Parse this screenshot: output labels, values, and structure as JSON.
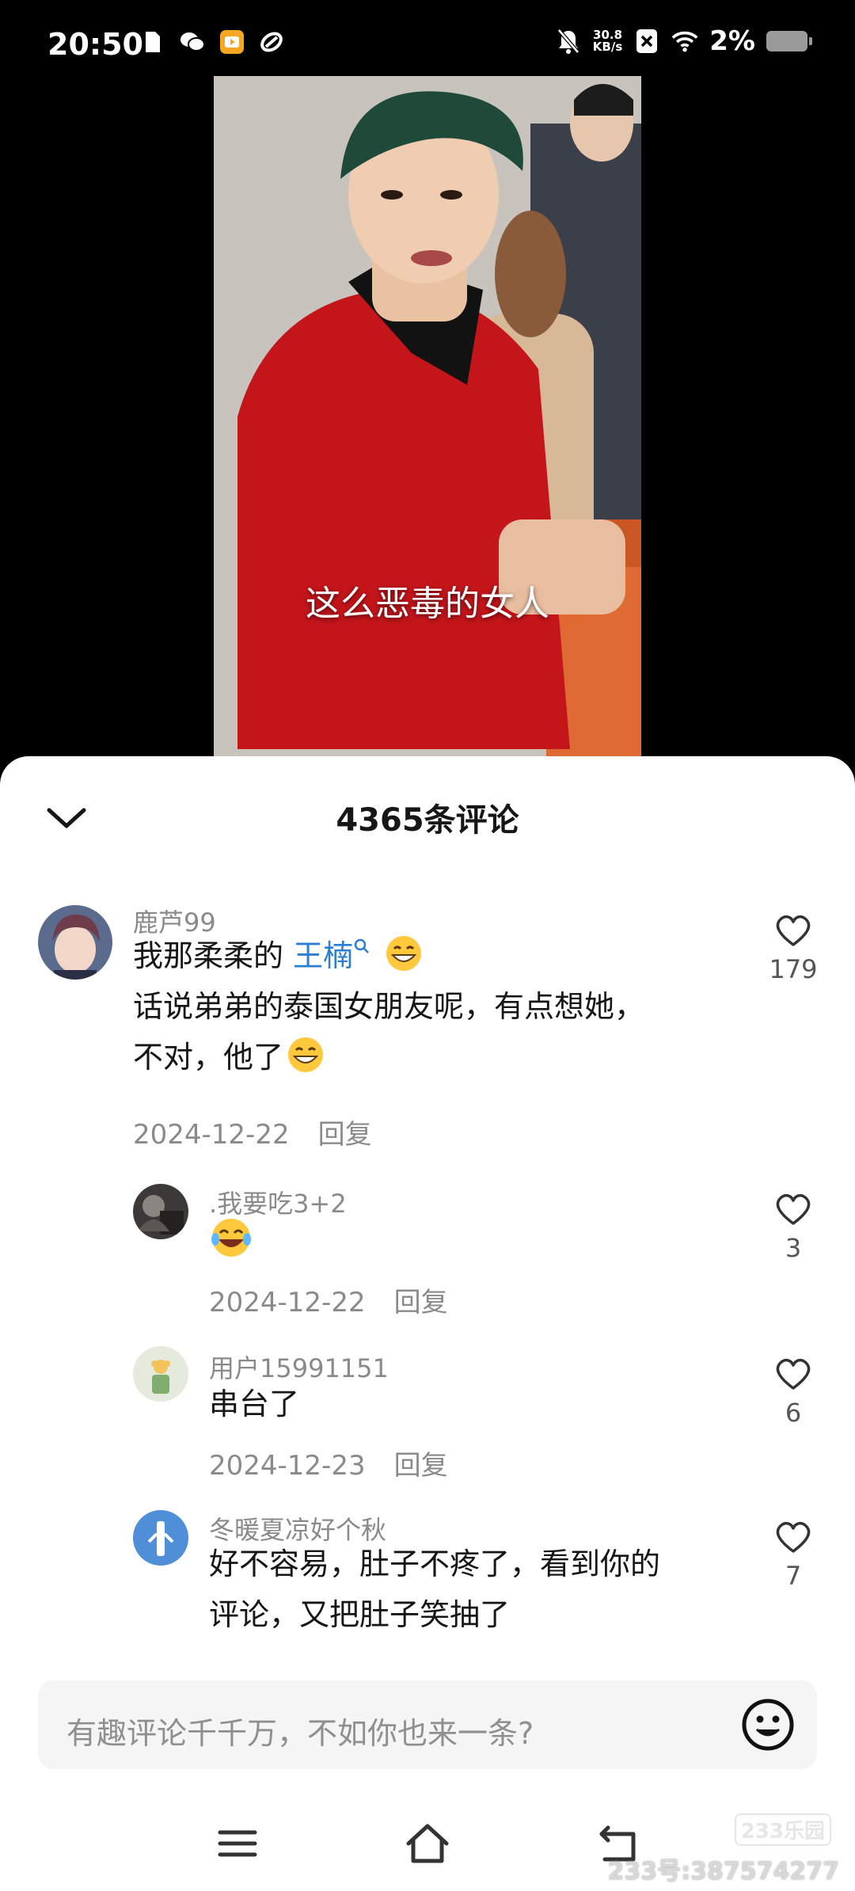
{
  "status_bar": {
    "time": "20:50",
    "net_speed_value": "30.8",
    "net_speed_unit": "KB/s",
    "battery_percent": "2%",
    "icons": [
      "sim-icon",
      "wechat-icon",
      "app-icon",
      "link-icon",
      "mute-icon",
      "close-box-icon",
      "wifi-icon",
      "battery-icon"
    ]
  },
  "video": {
    "caption": "这么恶毒的女人"
  },
  "comments_sheet": {
    "title": "4365条评论",
    "comments": [
      {
        "username": "鹿芦99",
        "text_line1_prefix": "我那柔柔的 ",
        "mention": "王楠",
        "text_line2": "话说弟弟的泰国女朋友呢，有点想她，",
        "text_line3": "不对，他了",
        "date": "2024-12-22",
        "reply_label": "回复",
        "likes": "179"
      },
      {
        "username": ".我要吃3+2",
        "text": "",
        "date": "2024-12-22",
        "reply_label": "回复",
        "likes": "3"
      },
      {
        "username": "用户15991151",
        "text": "串台了",
        "date": "2024-12-23",
        "reply_label": "回复",
        "likes": "6"
      },
      {
        "username": "冬暖夏凉好个秋",
        "text_line1": "好不容易，肚子不疼了，看到你的",
        "text_line2": "评论，又把肚子笑抽了",
        "likes": "7"
      }
    ]
  },
  "input": {
    "placeholder": "有趣评论千千万，不如你也来一条?"
  },
  "watermark": {
    "logo": "233乐园",
    "id_text": "233号:387574277"
  },
  "colors": {
    "mention": "#2b7fd2",
    "secondary_text": "#8a8a8a",
    "sheet_bg": "#ffffff"
  }
}
